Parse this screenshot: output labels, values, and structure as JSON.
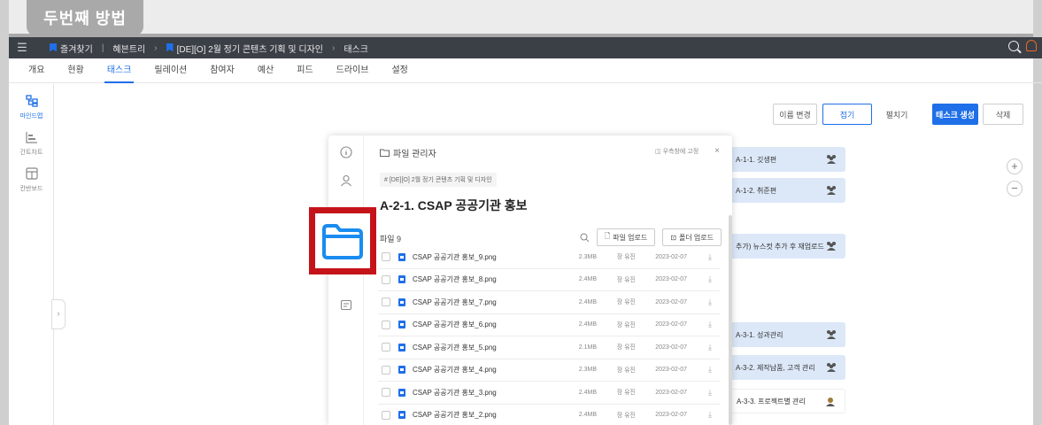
{
  "caption": "두번째 방법",
  "topbar": {
    "crumbs": [
      "즐겨찾기",
      "혜븐트리",
      "[DE][O] 2월 정기 콘텐츠 기획 및 디자인",
      "태스크"
    ]
  },
  "tabs": [
    "개요",
    "현황",
    "태스크",
    "릴레이션",
    "참여자",
    "예산",
    "피드",
    "드라이브",
    "설정"
  ],
  "active_tab": "태스크",
  "sidebar": [
    {
      "label": "마인드맵",
      "icon": "mindmap-icon",
      "active": true
    },
    {
      "label": "간트차트",
      "icon": "gantt-icon",
      "active": false
    },
    {
      "label": "칸반보드",
      "icon": "kanban-icon",
      "active": false
    }
  ],
  "actions": {
    "rename": "이름 변경",
    "collapse": "접기",
    "expand": "펼치기",
    "create_task": "태스크 생성",
    "delete": "삭제"
  },
  "nodes": [
    "A-1-1. 깃생편",
    "A-1-2. 취준편",
    "추가) 뉴스컷 추가 후 재업로드",
    "A-3-1. 성과관리",
    "A-3-2. 제작납품, 고객 관리",
    "A-3-3. 프로젝트별 관리"
  ],
  "panel": {
    "header": "파일 관리자",
    "view_right": "우측창에 고정",
    "crumb": "# [DE][O] 2월 정기 콘텐츠 기획 및 디자인",
    "title": "A-2-1. CSAP 공공기관 홍보",
    "count": "파일 9",
    "upload_file": "파일 업로드",
    "upload_folder": "폴더 업로드",
    "files": [
      {
        "name": "CSAP 공공기관 홍보_9.png",
        "size": "2.3MB",
        "user": "장 유진",
        "date": "2023-02-07"
      },
      {
        "name": "CSAP 공공기관 홍보_8.png",
        "size": "2.4MB",
        "user": "장 유진",
        "date": "2023-02-07"
      },
      {
        "name": "CSAP 공공기관 홍보_7.png",
        "size": "2.4MB",
        "user": "장 유진",
        "date": "2023-02-07"
      },
      {
        "name": "CSAP 공공기관 홍보_6.png",
        "size": "2.4MB",
        "user": "장 유진",
        "date": "2023-02-07"
      },
      {
        "name": "CSAP 공공기관 홍보_5.png",
        "size": "2.1MB",
        "user": "장 유진",
        "date": "2023-02-07"
      },
      {
        "name": "CSAP 공공기관 홍보_4.png",
        "size": "2.3MB",
        "user": "장 유진",
        "date": "2023-02-07"
      },
      {
        "name": "CSAP 공공기관 홍보_3.png",
        "size": "2.4MB",
        "user": "장 유진",
        "date": "2023-02-07"
      },
      {
        "name": "CSAP 공공기관 홍보_2.png",
        "size": "2.4MB",
        "user": "장 유진",
        "date": "2023-02-07"
      }
    ]
  },
  "colors": {
    "accent": "#1f6fe8",
    "highlight": "#c4141a",
    "topbar": "#3b3f46"
  }
}
